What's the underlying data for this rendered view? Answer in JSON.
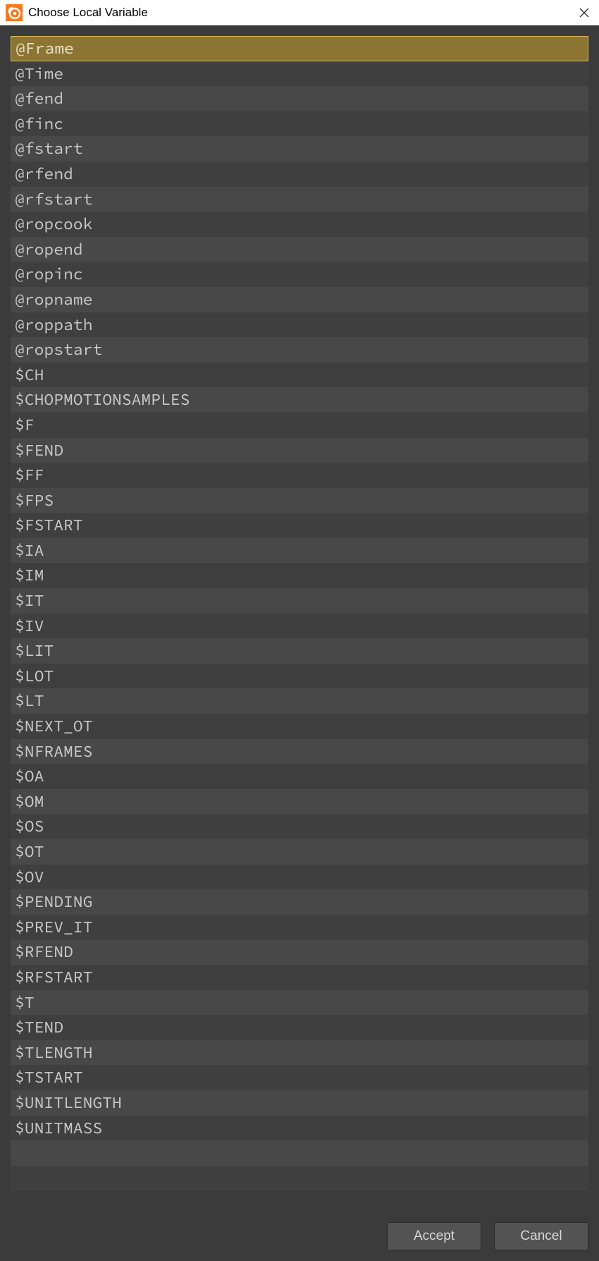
{
  "titlebar": {
    "title": "Choose Local Variable"
  },
  "list": {
    "selected_index": 0,
    "items": [
      "@Frame",
      "@Time",
      "@fend",
      "@finc",
      "@fstart",
      "@rfend",
      "@rfstart",
      "@ropcook",
      "@ropend",
      "@ropinc",
      "@ropname",
      "@roppath",
      "@ropstart",
      "$CH",
      "$CHOPMOTIONSAMPLES",
      "$F",
      "$FEND",
      "$FF",
      "$FPS",
      "$FSTART",
      "$IA",
      "$IM",
      "$IT",
      "$IV",
      "$LIT",
      "$LOT",
      "$LT",
      "$NEXT_OT",
      "$NFRAMES",
      "$OA",
      "$OM",
      "$OS",
      "$OT",
      "$OV",
      "$PENDING",
      "$PREV_IT",
      "$RFEND",
      "$RFSTART",
      "$T",
      "$TEND",
      "$TLENGTH",
      "$TSTART",
      "$UNITLENGTH",
      "$UNITMASS"
    ],
    "trailing_empty_rows": 2
  },
  "buttons": {
    "accept_label": "Accept",
    "cancel_label": "Cancel"
  }
}
